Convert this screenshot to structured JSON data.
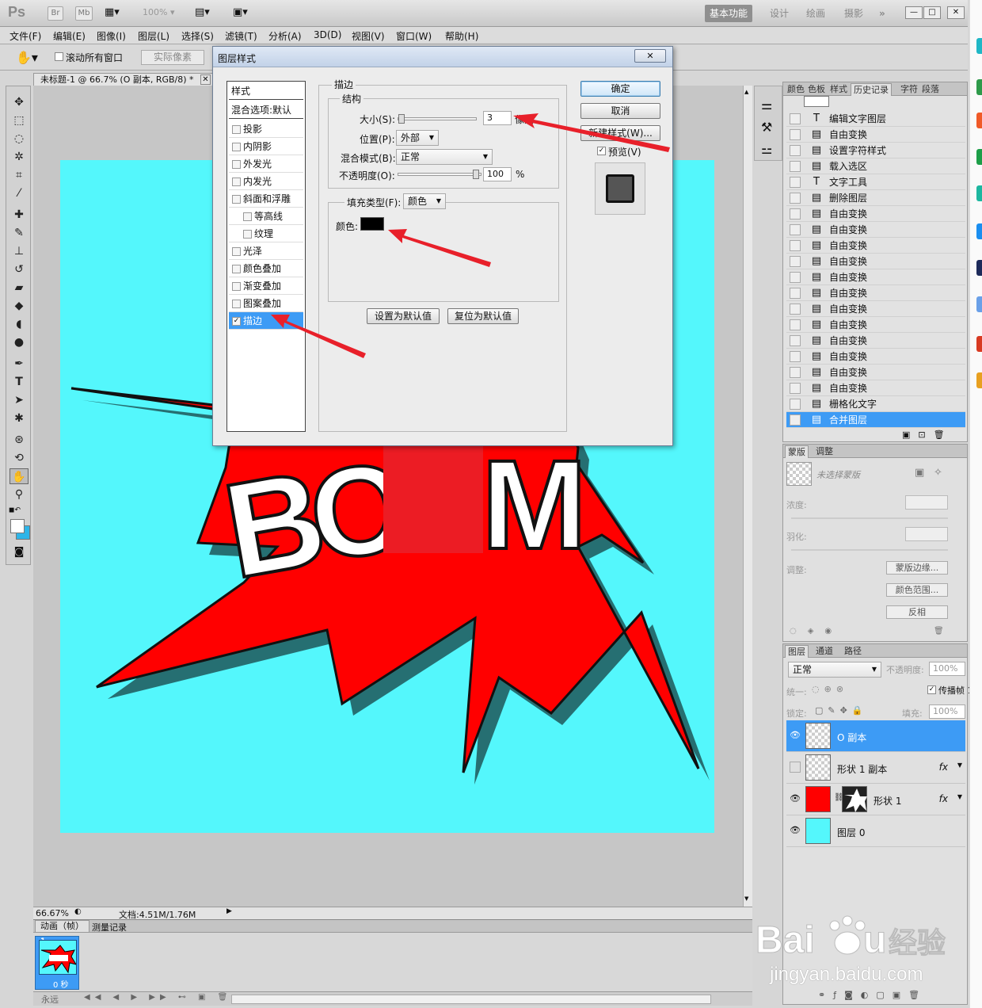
{
  "appbar": {
    "logo": "Ps",
    "br": "Br",
    "mb": "Mb",
    "zoom_dropdown": "100%",
    "workspaces": [
      "基本功能",
      "设计",
      "绘画",
      "摄影"
    ],
    "more": "»"
  },
  "menubar": [
    "文件(F)",
    "编辑(E)",
    "图像(I)",
    "图层(L)",
    "选择(S)",
    "滤镜(T)",
    "分析(A)",
    "3D(D)",
    "视图(V)",
    "窗口(W)",
    "帮助(H)"
  ],
  "options": {
    "scroll_all_label": "滚动所有窗口",
    "actual_pixels": "实际像素"
  },
  "document": {
    "tab_title": "未标题-1 @ 66.7% (O 副本, RGB/8) *",
    "zoom": "66.67%",
    "doc_info": "文档:4.51M/1.76M",
    "art_letters": [
      "B",
      "O",
      "M"
    ]
  },
  "animation": {
    "tabs": [
      "动画（帧）",
      "测量记录"
    ],
    "frame_number": "1",
    "frame_delay": "0 秒",
    "loop": "永远"
  },
  "history": {
    "tabs": [
      "颜色",
      "色板",
      "样式",
      "历史记录",
      "字符",
      "段落"
    ],
    "items": [
      {
        "icon": "T",
        "label": "编辑文字图层"
      },
      {
        "icon": "▤",
        "label": "自由变换"
      },
      {
        "icon": "▤",
        "label": "设置字符样式"
      },
      {
        "icon": "▤",
        "label": "载入选区"
      },
      {
        "icon": "T",
        "label": "文字工具"
      },
      {
        "icon": "▤",
        "label": "删除图层"
      },
      {
        "icon": "▤",
        "label": "自由变换"
      },
      {
        "icon": "▤",
        "label": "自由变换"
      },
      {
        "icon": "▤",
        "label": "自由变换"
      },
      {
        "icon": "▤",
        "label": "自由变换"
      },
      {
        "icon": "▤",
        "label": "自由变换"
      },
      {
        "icon": "▤",
        "label": "自由变换"
      },
      {
        "icon": "▤",
        "label": "自由变换"
      },
      {
        "icon": "▤",
        "label": "自由变换"
      },
      {
        "icon": "▤",
        "label": "自由变换"
      },
      {
        "icon": "▤",
        "label": "自由变换"
      },
      {
        "icon": "▤",
        "label": "自由变换"
      },
      {
        "icon": "▤",
        "label": "自由变换"
      },
      {
        "icon": "▤",
        "label": "栅格化文字"
      },
      {
        "icon": "▤",
        "label": "合并图层"
      }
    ]
  },
  "masks": {
    "tabs": [
      "蒙版",
      "调整"
    ],
    "no_selection": "未选择蒙版",
    "density": "浓度:",
    "feather": "羽化:",
    "refine": "调整:",
    "buttons": [
      "蒙版边缘...",
      "颜色范围...",
      "反相"
    ]
  },
  "layers": {
    "tabs": [
      "图层",
      "通道",
      "路径"
    ],
    "blend_mode": "正常",
    "opacity_label": "不透明度:",
    "opacity": "100%",
    "unify_label": "统一:",
    "propagate_label": "传播帧 1",
    "lock_label": "锁定:",
    "fill_label": "填充:",
    "fill": "100%",
    "items": [
      {
        "name": "O 副本",
        "visible": true,
        "fx": ""
      },
      {
        "name": "形状 1 副本",
        "visible": false,
        "fx": "fx"
      },
      {
        "name": "形状 1",
        "visible": true,
        "fx": "fx"
      },
      {
        "name": "图层 0",
        "visible": true,
        "fx": ""
      }
    ]
  },
  "dialog": {
    "title": "图层样式",
    "styles_header": "样式",
    "blend_defaults": "混合选项:默认",
    "styles": [
      {
        "label": "投影",
        "checked": false,
        "indent": false
      },
      {
        "label": "内阴影",
        "checked": false,
        "indent": false
      },
      {
        "label": "外发光",
        "checked": false,
        "indent": false
      },
      {
        "label": "内发光",
        "checked": false,
        "indent": false
      },
      {
        "label": "斜面和浮雕",
        "checked": false,
        "indent": false
      },
      {
        "label": "等高线",
        "checked": false,
        "indent": true
      },
      {
        "label": "纹理",
        "checked": false,
        "indent": true
      },
      {
        "label": "光泽",
        "checked": false,
        "indent": false
      },
      {
        "label": "颜色叠加",
        "checked": false,
        "indent": false
      },
      {
        "label": "渐变叠加",
        "checked": false,
        "indent": false
      },
      {
        "label": "图案叠加",
        "checked": false,
        "indent": false
      },
      {
        "label": "描边",
        "checked": true,
        "indent": false
      }
    ],
    "stroke_title": "描边",
    "structure_title": "结构",
    "size_label": "大小(S):",
    "size_value": "3",
    "size_unit": "像素",
    "position_label": "位置(P):",
    "position_value": "外部",
    "blend_label": "混合模式(B):",
    "blend_value": "正常",
    "opacity_label": "不透明度(O):",
    "opacity_value": "100",
    "opacity_unit": "%",
    "fill_type_label": "填充类型(F):",
    "fill_type_value": "颜色",
    "color_label": "颜色:",
    "make_default": "设置为默认值",
    "reset_default": "复位为默认值",
    "ok": "确定",
    "cancel": "取消",
    "new_style": "新建样式(W)...",
    "preview_label": "预览(V)"
  },
  "watermark": {
    "text": "jingyan.baidu.com"
  },
  "colors": {
    "canvas": "#54f7fc",
    "burst": "#ff0000",
    "selection": "#3d9bf5",
    "stroke_color": "#000000",
    "arrow": "#e8202a"
  }
}
